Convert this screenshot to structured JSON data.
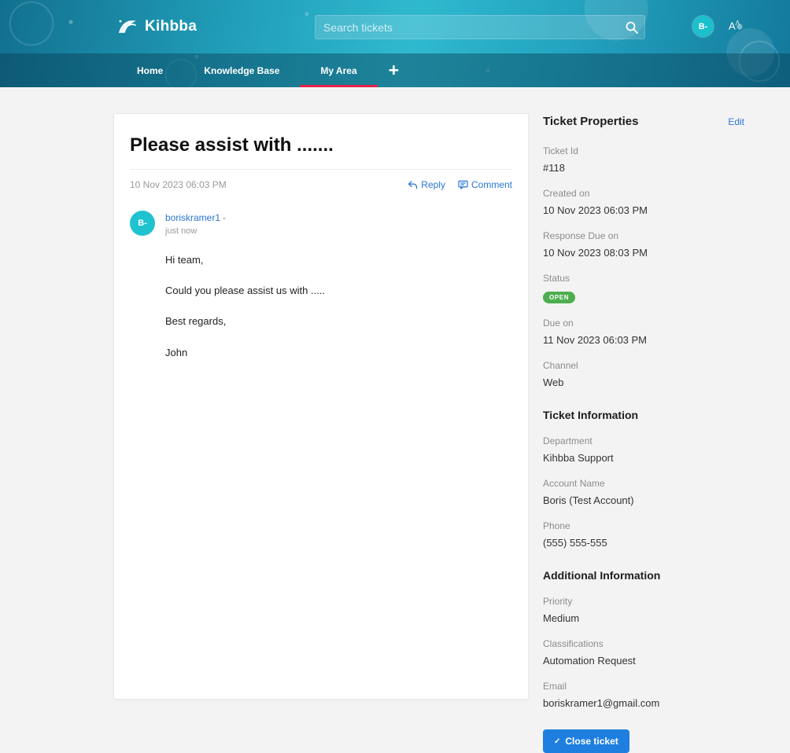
{
  "header": {
    "brand": "Kihbba",
    "search": {
      "placeholder": "Search tickets"
    },
    "avatar": "B-",
    "font_size": "A"
  },
  "nav": {
    "items": [
      {
        "label": "Home"
      },
      {
        "label": "Knowledge Base"
      },
      {
        "label": "My Area"
      }
    ],
    "add": "+"
  },
  "ticket": {
    "title": "Please assist with .......",
    "date": "10 Nov 2023 06:03 PM",
    "actions": {
      "reply": "Reply",
      "comment": "Comment"
    },
    "thread": {
      "avatar": "B-",
      "author": "boriskramer1",
      "author_suffix": "-",
      "time": "just now",
      "lines": [
        "Hi team,",
        "Could you please assist us with .....",
        "Best regards,",
        "John"
      ]
    }
  },
  "sidebar": {
    "title": "Ticket Properties",
    "edit": "Edit",
    "properties": [
      {
        "label": "Ticket Id",
        "value": "#118"
      },
      {
        "label": "Created on",
        "value": "10 Nov 2023 06:03 PM"
      },
      {
        "label": "Response Due on",
        "value": "10 Nov 2023 08:03 PM"
      },
      {
        "label": "Status",
        "value": "OPEN"
      },
      {
        "label": "Due on",
        "value": "11 Nov 2023 06:03 PM"
      },
      {
        "label": "Channel",
        "value": "Web"
      }
    ],
    "sections": [
      {
        "title": "Ticket Information",
        "items": [
          {
            "label": "Department",
            "value": "Kihbba Support"
          },
          {
            "label": "Account Name",
            "value": "Boris (Test Account)"
          },
          {
            "label": "Phone",
            "value": "(555) 555-555"
          }
        ]
      },
      {
        "title": "Additional Information",
        "items": [
          {
            "label": "Priority",
            "value": "Medium"
          },
          {
            "label": "Classifications",
            "value": "Automation Request"
          },
          {
            "label": "Email",
            "value": "boriskramer1@gmail.com"
          }
        ]
      }
    ],
    "close_check": "✓",
    "close_button": "Close ticket"
  },
  "colors": {
    "header_teal": "#2fb9cf",
    "nav_overlay": "#1b7a99",
    "active_tab_underline": "#e4234b",
    "link_blue": "#2a76d2",
    "status_green": "#4cae4f",
    "button_blue": "#1e7fe0",
    "avatar_teal": "#1fc3cf"
  }
}
